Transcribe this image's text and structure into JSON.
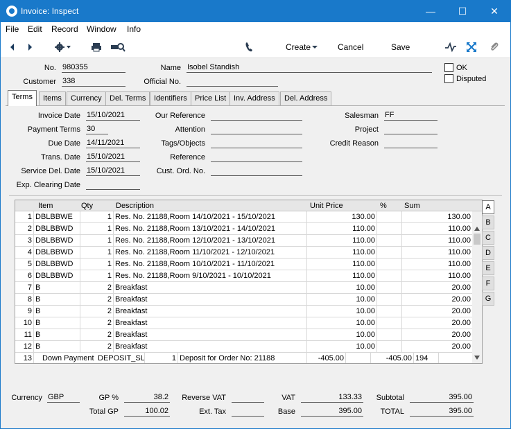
{
  "window": {
    "title": "Invoice: Inspect"
  },
  "menu": [
    "File",
    "Edit",
    "Record",
    "Window",
    "Info"
  ],
  "toolbar": {
    "create_label": "Create",
    "cancel_label": "Cancel",
    "save_label": "Save"
  },
  "header": {
    "no_label": "No.",
    "no_value": "980355",
    "name_label": "Name",
    "name_value": "Isobel Standish",
    "customer_label": "Customer",
    "customer_value": "338",
    "official_label": "Official No.",
    "official_value": "",
    "ok_label": "OK",
    "disputed_label": "Disputed"
  },
  "tabs": [
    "Terms",
    "Items",
    "Currency",
    "Del. Terms",
    "Identifiers",
    "Price List",
    "Inv. Address",
    "Del. Address"
  ],
  "terms": {
    "invoice_date_label": "Invoice Date",
    "invoice_date": "15/10/2021",
    "payment_terms_label": "Payment Terms",
    "payment_terms": "30",
    "due_date_label": "Due Date",
    "due_date": "14/11/2021",
    "trans_date_label": "Trans. Date",
    "trans_date": "15/10/2021",
    "service_del_date_label": "Service Del. Date",
    "service_del_date": "15/10/2021",
    "exp_clearing_date_label": "Exp. Clearing Date",
    "exp_clearing_date": "",
    "our_reference_label": "Our Reference",
    "our_reference": "",
    "attention_label": "Attention",
    "attention": "",
    "tags_label": "Tags/Objects",
    "tags": "",
    "reference_label": "Reference",
    "reference": "",
    "cust_ord_label": "Cust. Ord. No.",
    "cust_ord": "",
    "salesman_label": "Salesman",
    "salesman": "FF",
    "project_label": "Project",
    "project": "",
    "credit_reason_label": "Credit Reason",
    "credit_reason": ""
  },
  "grid": {
    "columns": [
      "Item",
      "Qty",
      "Description",
      "Unit Price",
      "%",
      "Sum"
    ],
    "rows": [
      [
        "1",
        "DBLBBWE",
        "1",
        "Res. No. 21188,Room  14/10/2021 - 15/10/2021",
        "130.00",
        "",
        "130.00"
      ],
      [
        "2",
        "DBLBBWD",
        "1",
        "Res. No. 21188,Room  13/10/2021 - 14/10/2021",
        "110.00",
        "",
        "110.00"
      ],
      [
        "3",
        "DBLBBWD",
        "1",
        "Res. No. 21188,Room  12/10/2021 - 13/10/2021",
        "110.00",
        "",
        "110.00"
      ],
      [
        "4",
        "DBLBBWD",
        "1",
        "Res. No. 21188,Room  11/10/2021 - 12/10/2021",
        "110.00",
        "",
        "110.00"
      ],
      [
        "5",
        "DBLBBWD",
        "1",
        "Res. No. 21188,Room  10/10/2021 - 11/10/2021",
        "110.00",
        "",
        "110.00"
      ],
      [
        "6",
        "DBLBBWD",
        "1",
        "Res. No. 21188,Room  9/10/2021 - 10/10/2021",
        "110.00",
        "",
        "110.00"
      ],
      [
        "7",
        "B",
        "2",
        "Breakfast",
        "10.00",
        "",
        "20.00"
      ],
      [
        "8",
        "B",
        "2",
        "Breakfast",
        "10.00",
        "",
        "20.00"
      ],
      [
        "9",
        "B",
        "2",
        "Breakfast",
        "10.00",
        "",
        "20.00"
      ],
      [
        "10",
        "B",
        "2",
        "Breakfast",
        "10.00",
        "",
        "20.00"
      ],
      [
        "11",
        "B",
        "2",
        "Breakfast",
        "10.00",
        "",
        "20.00"
      ],
      [
        "12",
        "B",
        "2",
        "Breakfast",
        "10.00",
        "",
        "20.00"
      ]
    ],
    "row13": {
      "no": "13",
      "item": "Down Payment",
      "code": "DEPOSIT_SL",
      "qty": "1",
      "desc": "Deposit for Order No: 21188",
      "price": "-405.00",
      "sum": "-405.00",
      "extra": "194"
    },
    "side_tabs": [
      "A",
      "B",
      "C",
      "D",
      "E",
      "F",
      "G"
    ]
  },
  "footer": {
    "currency_label": "Currency",
    "currency": "GBP",
    "gp_pct_label": "GP %",
    "gp_pct": "38.2",
    "total_gp_label": "Total GP",
    "total_gp": "100.02",
    "reverse_vat_label": "Reverse VAT",
    "reverse_vat": "",
    "ext_tax_label": "Ext. Tax",
    "ext_tax": "",
    "vat_label": "VAT",
    "vat": "133.33",
    "base_label": "Base",
    "base": "395.00",
    "subtotal_label": "Subtotal",
    "subtotal": "395.00",
    "total_label": "TOTAL",
    "total": "395.00"
  }
}
